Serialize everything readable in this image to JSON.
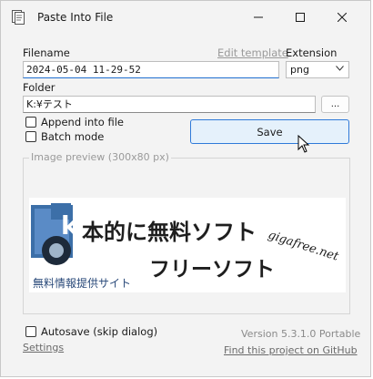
{
  "window": {
    "title": "Paste Into File"
  },
  "form": {
    "filename_label": "Filename",
    "edit_template_label": "Edit template",
    "extension_label": "Extension",
    "filename_value": "2024-05-04 11-29-52",
    "extension_value": "png",
    "folder_label": "Folder",
    "folder_value": "K:¥テスト",
    "browse_label": "...",
    "append_label": "Append into file",
    "batch_label": "Batch mode",
    "save_label": "Save"
  },
  "preview": {
    "title": "Image preview (300x80 px)",
    "image_text": {
      "main": "本的に無料ソフト",
      "sub": "フリーソフト",
      "caption": "無料情報提供サイト",
      "brand": "gigafree.net"
    }
  },
  "footer": {
    "autosave_label": "Autosave (skip dialog)",
    "version": "Version 5.3.1.0 Portable",
    "settings_link": "Settings",
    "github_link": "Find this project on GitHub"
  },
  "colors": {
    "accent": "#2f7ad9",
    "save_bg": "#e5f1fb",
    "window_bg": "#f3f3f3"
  }
}
